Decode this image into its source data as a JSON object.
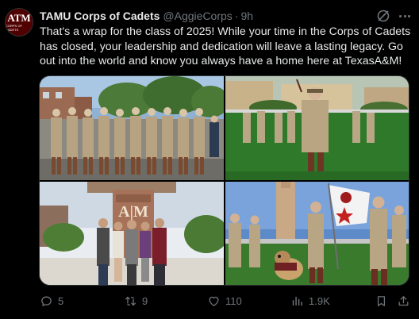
{
  "account": {
    "display_name": "TAMU Corps of Cadets",
    "handle": "@AggieCorps",
    "separator": "·",
    "time": "9h",
    "avatar_mark": "ATM",
    "avatar_sub": "CORPS OF CADETS"
  },
  "post": {
    "text": "That's a wrap for the class of 2025! While your time in the Corps of Cadets has closed, your leadership and dedication will leave a lasting legacy. Go out into the world and know you always have a home here at TexasA&M!"
  },
  "media": {
    "photos": [
      {
        "name": "cadets-line-up"
      },
      {
        "name": "cadets-march-field"
      },
      {
        "name": "family-at-aggie-ring-sign",
        "sign_text": "A|M"
      },
      {
        "name": "cadets-with-flag-and-mascot"
      }
    ]
  },
  "actions": {
    "replies": "5",
    "reposts": "9",
    "likes": "110",
    "views": "1.9K"
  },
  "colors": {
    "background": "#000000",
    "text": "#e7e9ea",
    "muted": "#71767b",
    "maroon": "#500000"
  },
  "icons": [
    "grok-icon",
    "more-icon",
    "reply-icon",
    "repost-icon",
    "like-icon",
    "views-icon",
    "bookmark-icon",
    "share-icon"
  ]
}
